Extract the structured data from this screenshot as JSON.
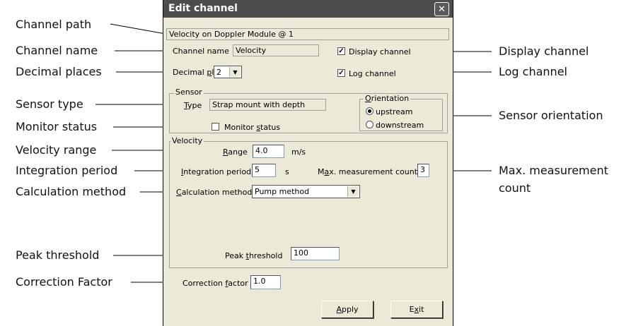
{
  "callouts": {
    "channel_path": "Channel path",
    "channel_name": "Channel name",
    "decimal_places": "Decimal places",
    "sensor_type": "Sensor type",
    "monitor_status": "Monitor status",
    "velocity_range": "Velocity range",
    "integration_period": "Integration period",
    "calculation_method": "Calculation method",
    "peak_threshold": "Peak threshold",
    "correction_factor": "Correction Factor",
    "display_channel": "Display channel",
    "log_channel": "Log channel",
    "sensor_orientation": "Sensor orientation",
    "max_measurement_count_line1": "Max. measurement",
    "max_measurement_count_line2": "count"
  },
  "dialog": {
    "title": "Edit channel",
    "close_glyph": "✕",
    "channel_path": "Velocity on Doppler Module @ 1",
    "channel_name_label": "Channel name",
    "channel_name_value": "Velocity",
    "display_channel_label": "Display channel",
    "display_channel_checked": true,
    "log_channel_label": "Log channel",
    "log_channel_checked": true,
    "decimal_places_label_pre": "Decimal ",
    "decimal_places_label_u": "p",
    "decimal_places_label_post": "laces",
    "decimal_places_value": "2",
    "sensor": {
      "group_title": "Sensor",
      "type_label_u": "T",
      "type_label_post": "ype",
      "type_value": "Strap mount with depth",
      "monitor_status_pre": "Monitor ",
      "monitor_status_u": "s",
      "monitor_status_post": "tatus",
      "monitor_status_checked": false,
      "orientation_title_u": "O",
      "orientation_title_post": "rientation",
      "upstream_label": "upstream",
      "downstream_label": "downstream",
      "selected": "upstream"
    },
    "velocity": {
      "group_title": "Velocity",
      "range_label_u": "R",
      "range_label_post": "ange",
      "range_value": "4.0",
      "range_unit": "m/s",
      "integration_label_u": "I",
      "integration_label_post": "ntegration period",
      "integration_value": "5",
      "integration_unit": "s",
      "max_count_pre": "M",
      "max_count_u": "a",
      "max_count_post": "x. measurement count",
      "max_count_value": "3",
      "calc_method_label_u": "C",
      "calc_method_label_post": "alculation method",
      "calc_method_value": "Pump method",
      "peak_label_pre": "Peak ",
      "peak_label_u": "t",
      "peak_label_post": "hreshold",
      "peak_value": "100"
    },
    "correction_label_pre": "Correction ",
    "correction_label_u": "f",
    "correction_label_post": "actor",
    "correction_value": "1.0",
    "apply_u": "A",
    "apply_post": "pply",
    "exit_pre": "E",
    "exit_u": "x",
    "exit_post": "it",
    "dropdown_arrow": "▼"
  }
}
